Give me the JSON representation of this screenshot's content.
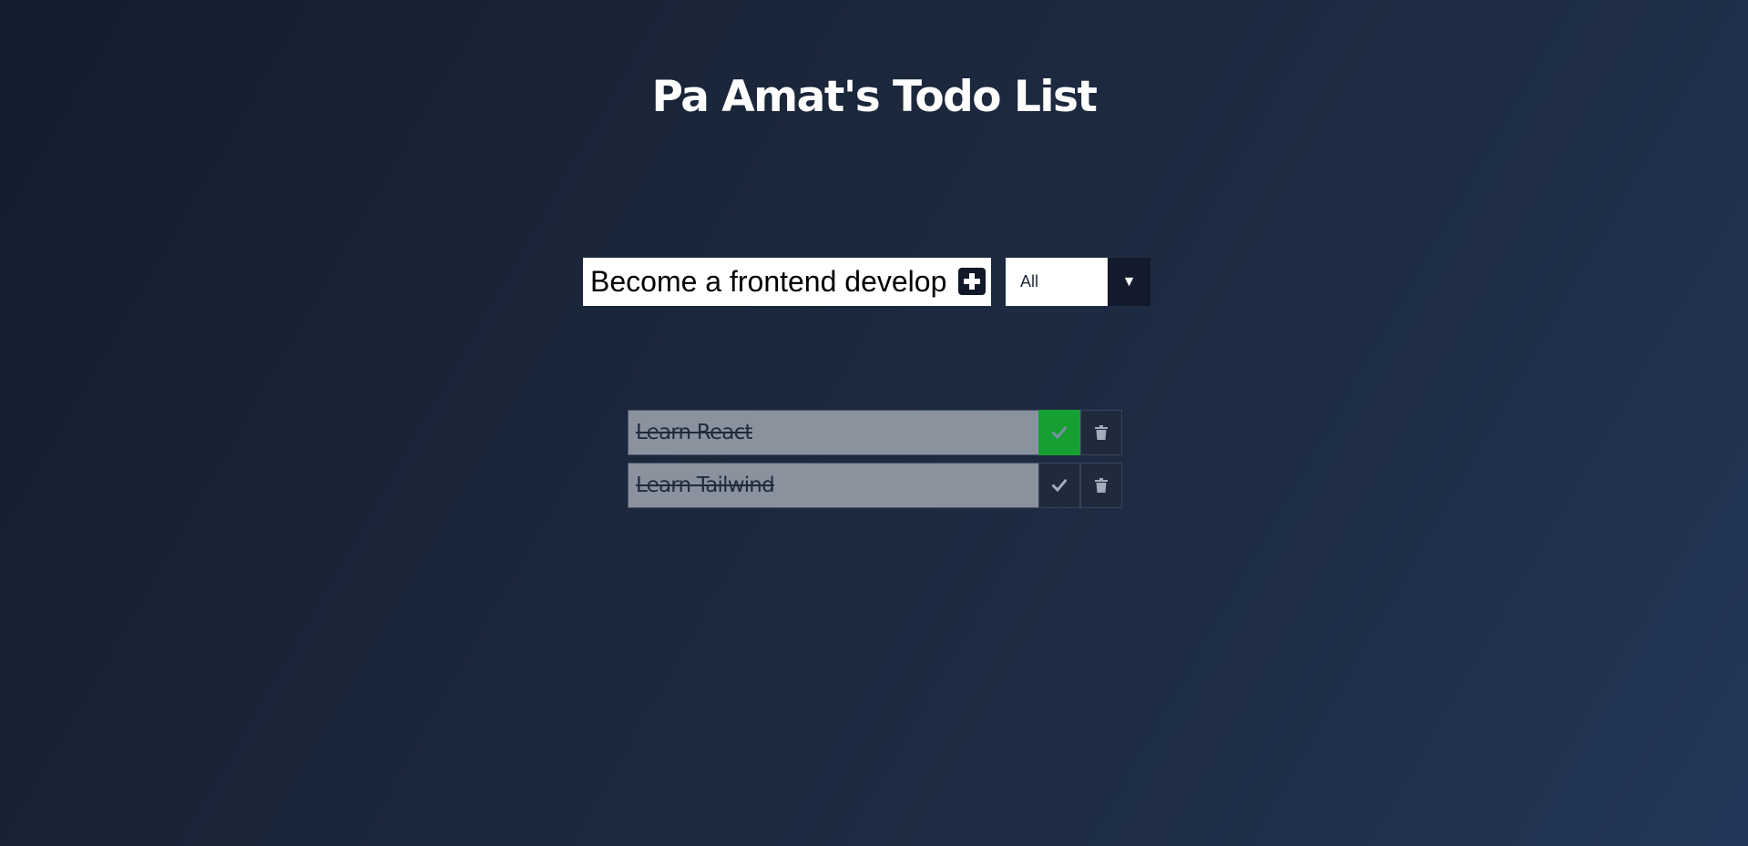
{
  "header": {
    "title": "Pa Amat's Todo List"
  },
  "form": {
    "input_value": "Become a frontend develop",
    "add_icon": "plus-square-icon"
  },
  "filter": {
    "selected": "All",
    "arrow_icon": "triangle-down-icon",
    "arrow_glyph": "▼"
  },
  "todos": [
    {
      "text": "Learn React",
      "completed": true,
      "check_icon": "check-icon",
      "trash_icon": "trash-icon"
    },
    {
      "text": "Learn Tailwind",
      "completed": false,
      "check_icon": "check-icon",
      "trash_icon": "trash-icon"
    }
  ],
  "colors": {
    "background_start": "#141d2d",
    "background_end": "#24375a",
    "completed_green": "#16a034",
    "todo_item_bg": "#8a929e",
    "button_dark": "#1f2a3c"
  }
}
